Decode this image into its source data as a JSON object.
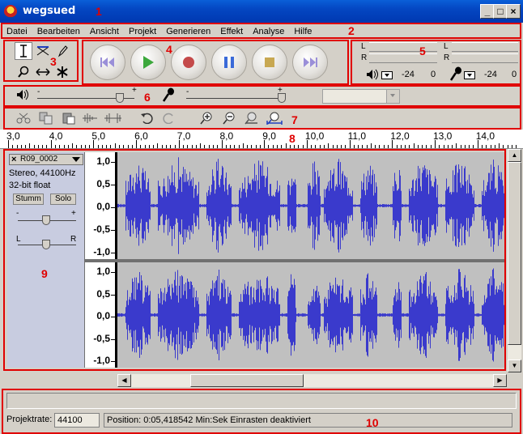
{
  "window": {
    "title": "wegsued",
    "minimize": "_",
    "maximize": "□",
    "close": "×"
  },
  "annotations": [
    "1",
    "2",
    "3",
    "4",
    "5",
    "6",
    "7",
    "8",
    "9",
    "10"
  ],
  "menu": [
    "Datei",
    "Bearbeiten",
    "Ansicht",
    "Projekt",
    "Generieren",
    "Effekt",
    "Analyse",
    "Hilfe"
  ],
  "meters": {
    "out_left": "L",
    "out_right": "R",
    "in_left": "L",
    "in_right": "R",
    "out_db_a": "-24",
    "out_db_b": "0",
    "in_db_a": "-24",
    "in_db_b": "0"
  },
  "mixer": {
    "plus": "+",
    "minus": "-"
  },
  "ruler": {
    "ticks": [
      "3,0",
      "4,0",
      "5,0",
      "6,0",
      "7,0",
      "8,0",
      "9,0",
      "10,0",
      "11,0",
      "12,0",
      "13,0",
      "14,0"
    ]
  },
  "track": {
    "name": "R09_0002",
    "format": "Stereo, 44100Hz",
    "bits": "32-bit float",
    "mute": "Stumm",
    "solo": "Solo",
    "gain_minus": "-",
    "gain_plus": "+",
    "pan_left": "L",
    "pan_right": "R"
  },
  "vruler_labels": [
    "1,0",
    "0,5",
    "0,0",
    "-0,5",
    "-1,0"
  ],
  "status": {
    "rate_label": "Projektrate:",
    "rate_value": "44100",
    "position": "Position: 0:05,418542 Min:Sek   Einrasten deaktiviert"
  },
  "colors": {
    "waveform": "#3a3acc",
    "annotation": "#e00000",
    "titlebar": "#0446c2"
  }
}
